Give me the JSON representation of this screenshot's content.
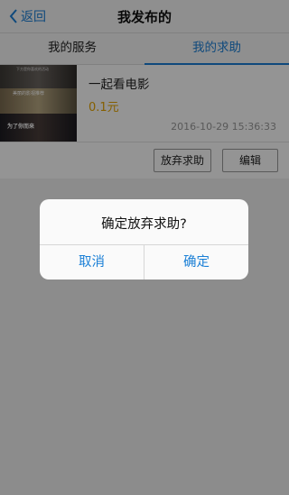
{
  "nav": {
    "back_label": "返回",
    "title": "我发布的"
  },
  "tabs": [
    {
      "label": "我的服务",
      "active": false
    },
    {
      "label": "我的求助",
      "active": true
    }
  ],
  "item": {
    "thumb_text_top": "下方是你喜欢的活动",
    "thumb_text_mid": "美丽的影视推荐",
    "thumb_text_bottom": "为了你而来",
    "title": "一起看电影",
    "price": "0.1元",
    "time": "2016-10-29 15:36:33",
    "abandon_label": "放弃求助",
    "edit_label": "编辑"
  },
  "dialog": {
    "message": "确定放弃求助?",
    "cancel_label": "取消",
    "confirm_label": "确定"
  },
  "colors": {
    "accent": "#1a7fd6",
    "price": "#e6a400"
  }
}
